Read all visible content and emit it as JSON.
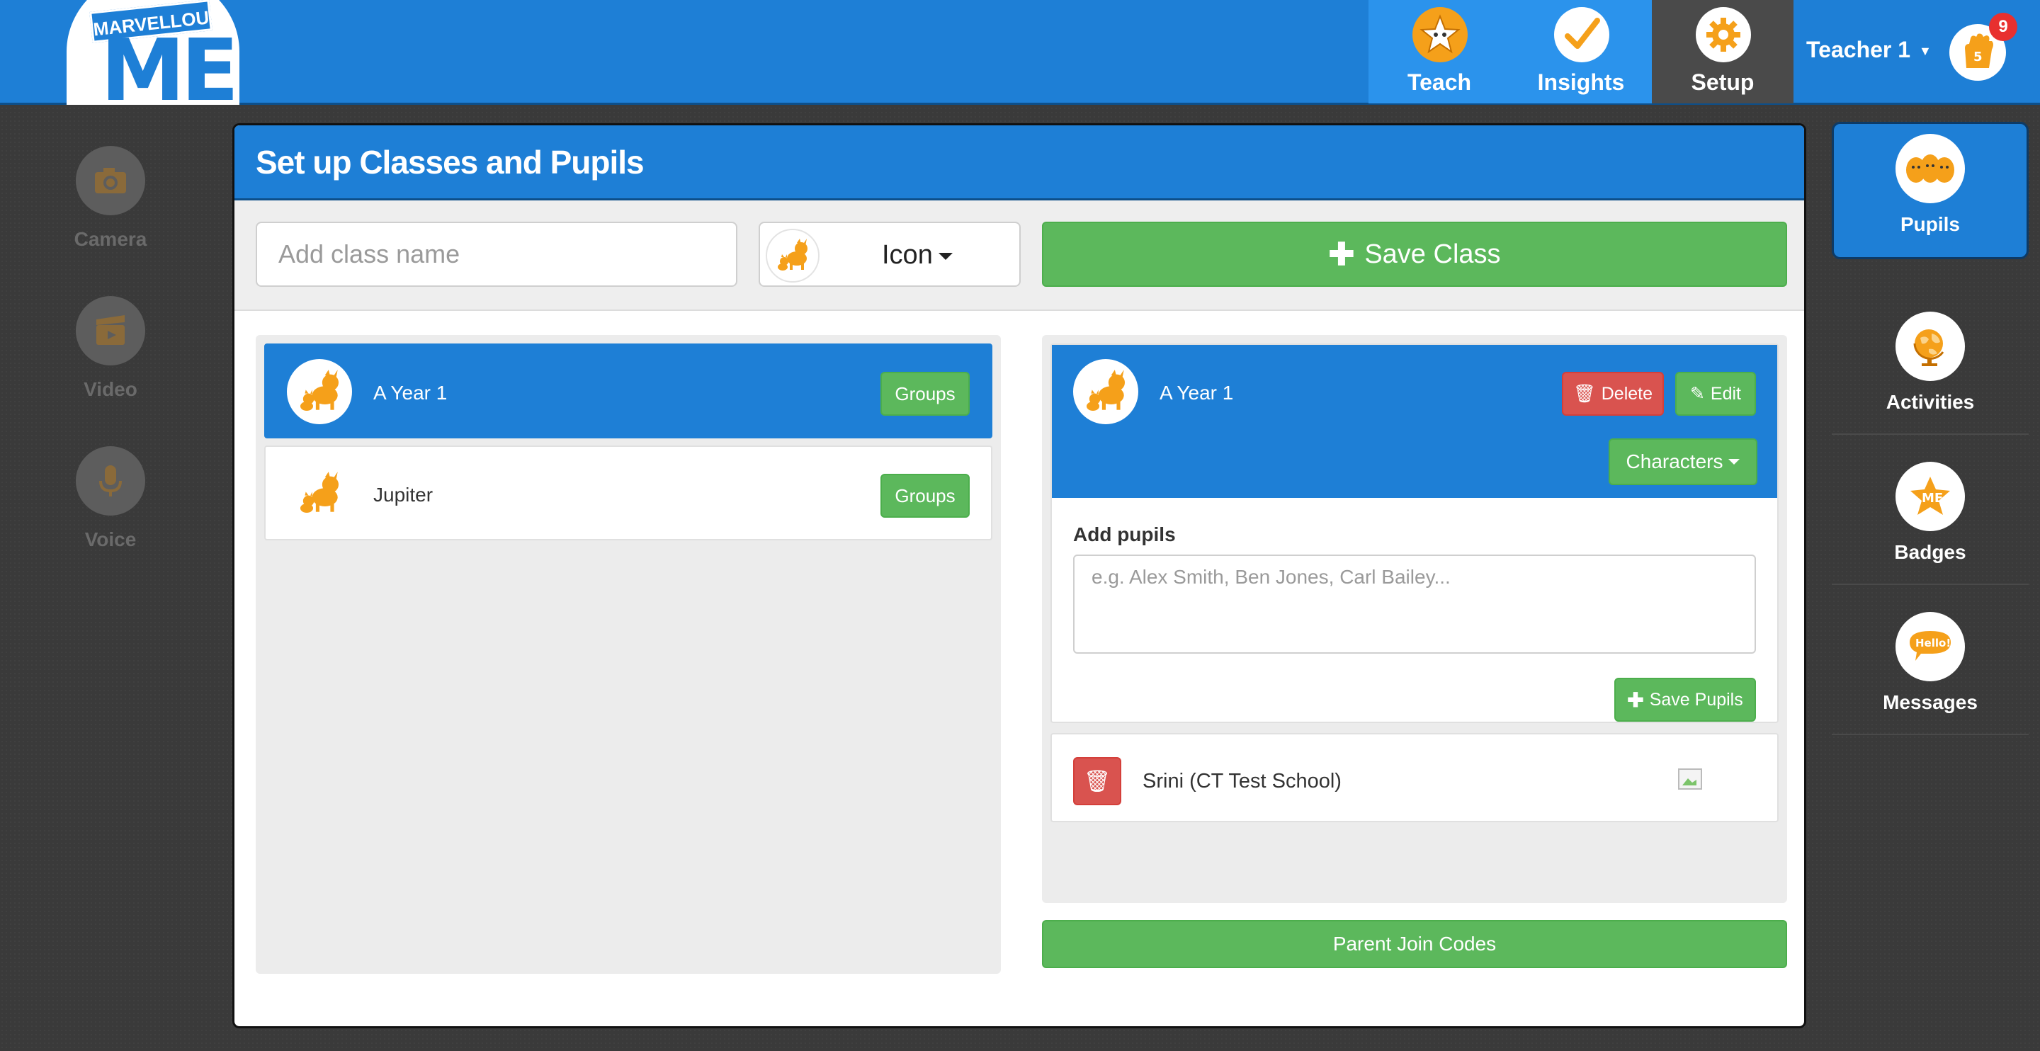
{
  "brand": {
    "logo_text": "MARVELLOUS",
    "logo_mark": "ME"
  },
  "topnav": {
    "tabs": [
      {
        "label": "Teach",
        "icon": "star-character-icon"
      },
      {
        "label": "Insights",
        "icon": "checkmark-icon"
      },
      {
        "label": "Setup",
        "icon": "gear-icon",
        "active": true
      }
    ],
    "user_label": "Teacher 1",
    "notification_count": "9"
  },
  "leftrail": {
    "items": [
      {
        "label": "Camera",
        "icon": "camera-icon"
      },
      {
        "label": "Video",
        "icon": "clapperboard-icon"
      },
      {
        "label": "Voice",
        "icon": "microphone-icon"
      }
    ]
  },
  "panel": {
    "title": "Set up Classes and Pupils",
    "class_name_placeholder": "Add class name",
    "icon_select_label": "Icon",
    "save_class_label": "Save Class"
  },
  "classes": [
    {
      "name": "A Year 1",
      "groups_label": "Groups",
      "active": true
    },
    {
      "name": "Jupiter",
      "groups_label": "Groups",
      "active": false
    }
  ],
  "detail": {
    "class_name": "A Year 1",
    "delete_label": "Delete",
    "edit_label": "Edit",
    "characters_label": "Characters",
    "add_pupils_label": "Add pupils",
    "add_pupils_placeholder": "e.g. Alex Smith, Ben Jones, Carl Bailey...",
    "save_pupils_label": "Save Pupils",
    "pupils": [
      {
        "name": "Srini (CT Test School)"
      }
    ],
    "parent_codes_label": "Parent Join Codes"
  },
  "rightrail": {
    "items": [
      {
        "label": "Pupils",
        "icon": "pupils-icon",
        "active": true
      },
      {
        "label": "Activities",
        "icon": "globe-icon"
      },
      {
        "label": "Badges",
        "icon": "badge-star-icon"
      },
      {
        "label": "Messages",
        "icon": "hello-speech-bubble-icon"
      }
    ]
  },
  "colors": {
    "primary_blue": "#1e7fd6",
    "green": "#5cb85c",
    "red": "#d9534f",
    "orange_icon": "#f5a01a",
    "background_dark": "#3a3a3a"
  }
}
